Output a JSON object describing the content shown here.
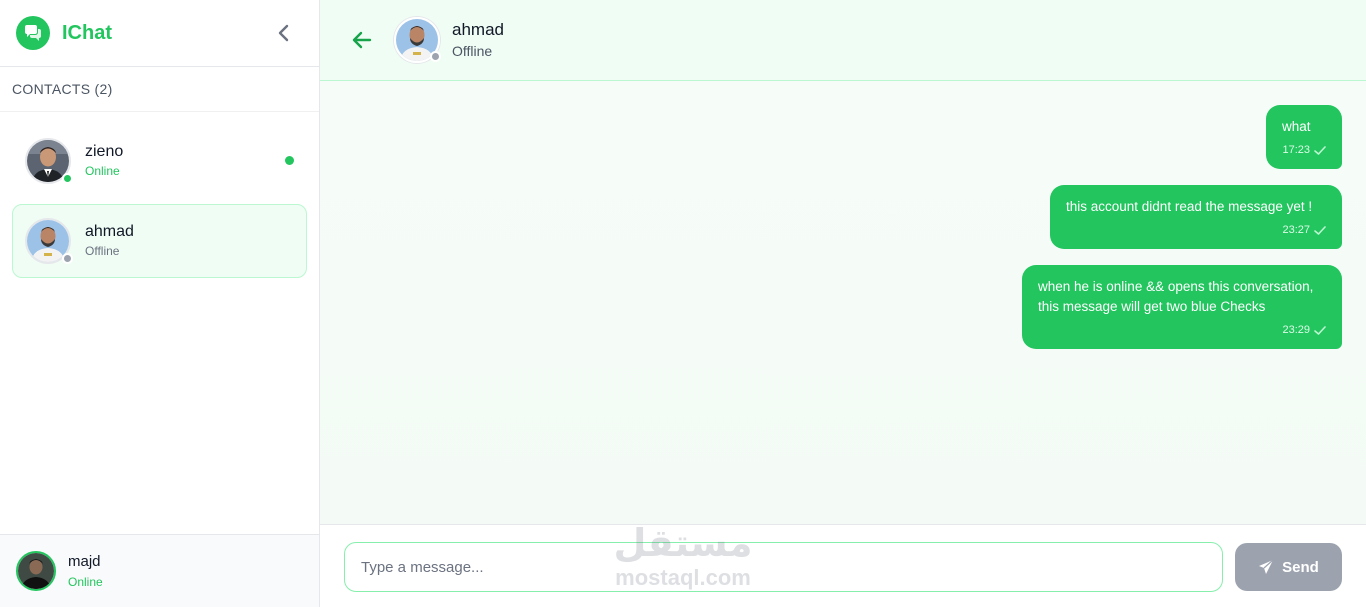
{
  "app": {
    "name": "IChat",
    "brand_color": "#22c55e",
    "logo_icon": "chat-bubbles-icon",
    "collapse_icon": "chevron-left-icon"
  },
  "sidebar": {
    "contacts_header": "CONTACTS (2)",
    "contacts": [
      {
        "name": "zieno",
        "status": "Online",
        "online": true,
        "unread": true,
        "active": false
      },
      {
        "name": "ahmad",
        "status": "Offline",
        "online": false,
        "unread": false,
        "active": true
      }
    ],
    "current_user": {
      "name": "majd",
      "status": "Online"
    }
  },
  "chat": {
    "back_icon": "arrow-left-icon",
    "contact": {
      "name": "ahmad",
      "status": "Offline"
    },
    "messages": [
      {
        "text": "what",
        "time": "17:23",
        "outgoing": true,
        "read": false
      },
      {
        "text": "this account didnt read the message yet !",
        "time": "23:27",
        "outgoing": true,
        "read": false
      },
      {
        "text_line1": "when he is online && opens this conversation,",
        "text_line2": "this message will get two blue Checks",
        "time": "23:29",
        "outgoing": true,
        "read": false
      }
    ]
  },
  "composer": {
    "placeholder": "Type a message...",
    "value": "",
    "send_label": "Send",
    "send_icon": "paper-plane-icon"
  },
  "watermark": {
    "arabic": "مستقل",
    "latin": "mostaql.com"
  }
}
